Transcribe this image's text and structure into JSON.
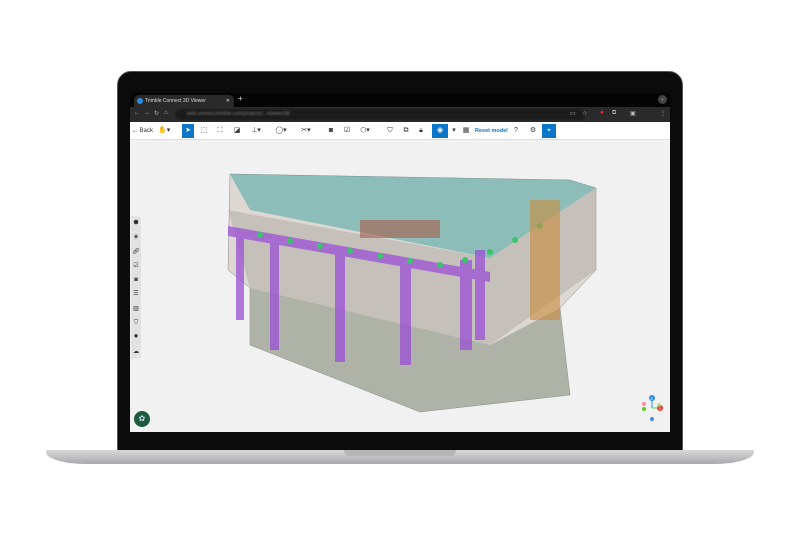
{
  "browser": {
    "tab_title": "Trimble Connect 3D Viewer",
    "new_tab": "+",
    "url": "web.connect.trimble.com/projects/.../viewer/3d"
  },
  "toolbar": {
    "back_label": "Back",
    "reset_label": "Reset model"
  },
  "sidebar": {
    "items": [
      "objects",
      "layers",
      "links",
      "todo",
      "views",
      "properties",
      "sheets",
      "clash",
      "settings",
      "cloud"
    ]
  },
  "colors": {
    "accent": "#0c76c8",
    "logo": "#1e5b3e",
    "structure": "#9b4fd6",
    "pipes": "#3ac56b"
  },
  "axes": {
    "z": "Z",
    "x": "X"
  }
}
